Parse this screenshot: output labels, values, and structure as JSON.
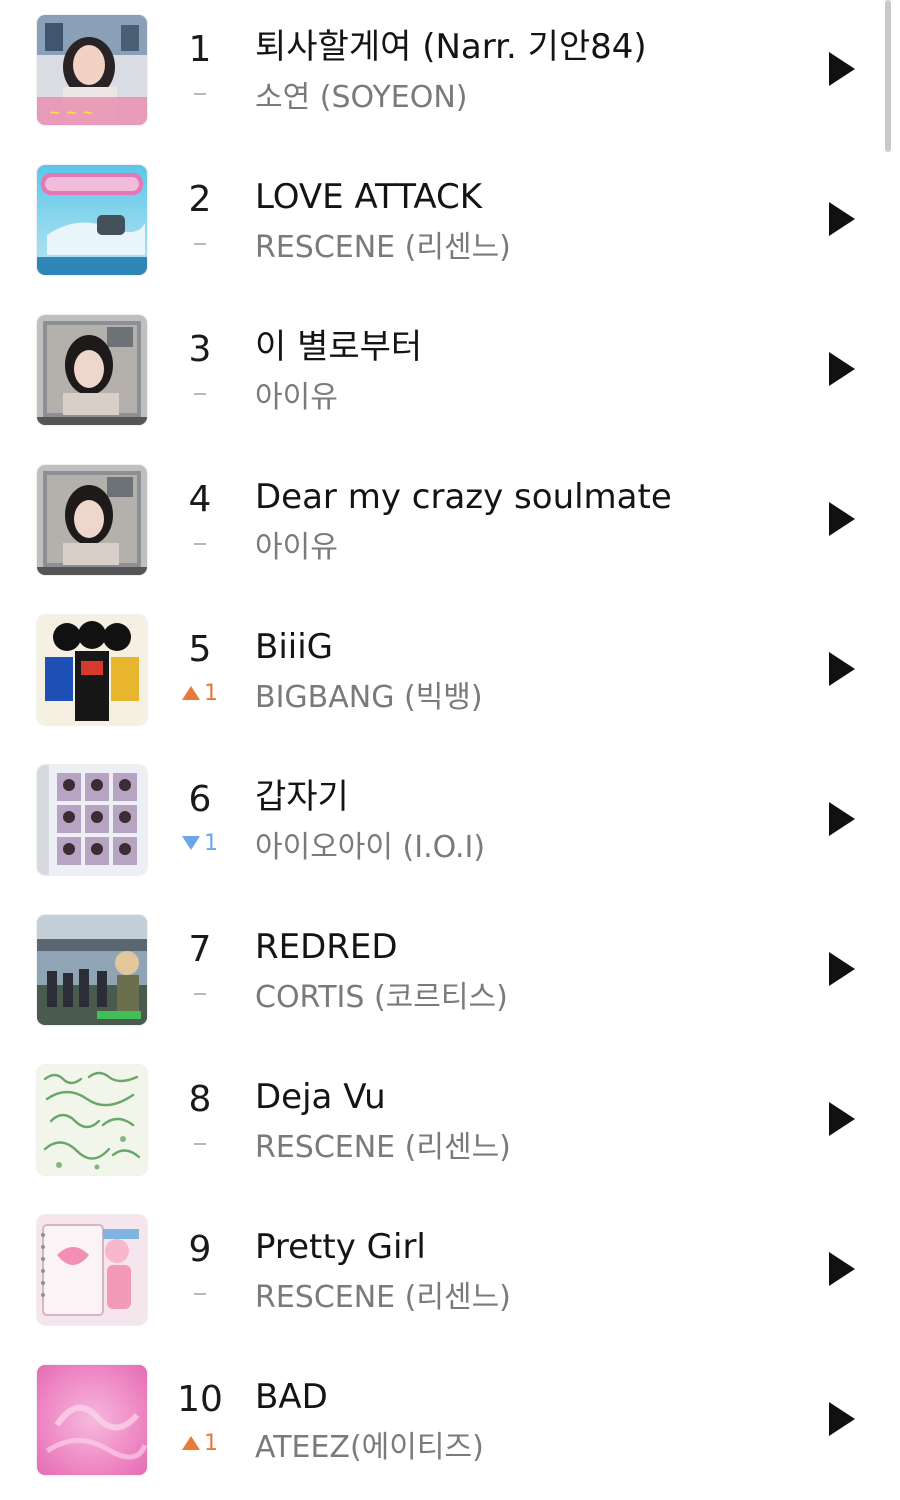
{
  "chart": {
    "entries": [
      {
        "rank": "1",
        "change": {
          "dir": "same",
          "amount": ""
        },
        "title": "퇴사할게여 (Narr. 기안84)",
        "artist": "소연 (SOYEON)",
        "icon": "play-icon"
      },
      {
        "rank": "2",
        "change": {
          "dir": "same",
          "amount": ""
        },
        "title": "LOVE ATTACK",
        "artist": "RESCENE (리센느)",
        "icon": "play-icon"
      },
      {
        "rank": "3",
        "change": {
          "dir": "same",
          "amount": ""
        },
        "title": "이 별로부터",
        "artist": "아이유",
        "icon": "play-icon"
      },
      {
        "rank": "4",
        "change": {
          "dir": "same",
          "amount": ""
        },
        "title": "Dear my crazy soulmate",
        "artist": "아이유",
        "icon": "play-icon"
      },
      {
        "rank": "5",
        "change": {
          "dir": "up",
          "amount": "1"
        },
        "title": "BiiiG",
        "artist": "BIGBANG (빅뱅)",
        "icon": "play-icon"
      },
      {
        "rank": "6",
        "change": {
          "dir": "down",
          "amount": "1"
        },
        "title": "갑자기",
        "artist": "아이오아이 (I.O.I)",
        "icon": "play-icon"
      },
      {
        "rank": "7",
        "change": {
          "dir": "same",
          "amount": ""
        },
        "title": "REDRED",
        "artist": "CORTIS (코르티스)",
        "icon": "play-icon"
      },
      {
        "rank": "8",
        "change": {
          "dir": "same",
          "amount": ""
        },
        "title": "Deja Vu",
        "artist": "RESCENE (리센느)",
        "icon": "play-icon"
      },
      {
        "rank": "9",
        "change": {
          "dir": "same",
          "amount": ""
        },
        "title": "Pretty Girl",
        "artist": "RESCENE (리센느)",
        "icon": "play-icon"
      },
      {
        "rank": "10",
        "change": {
          "dir": "up",
          "amount": "1"
        },
        "title": "BAD",
        "artist": "ATEEZ(에이티즈)",
        "icon": "play-icon"
      }
    ]
  },
  "colors": {
    "rank_up": "#e8793a",
    "rank_down": "#6aa6e8",
    "rank_same": "#b8b8b8",
    "artist_text": "#7a7a7a"
  }
}
